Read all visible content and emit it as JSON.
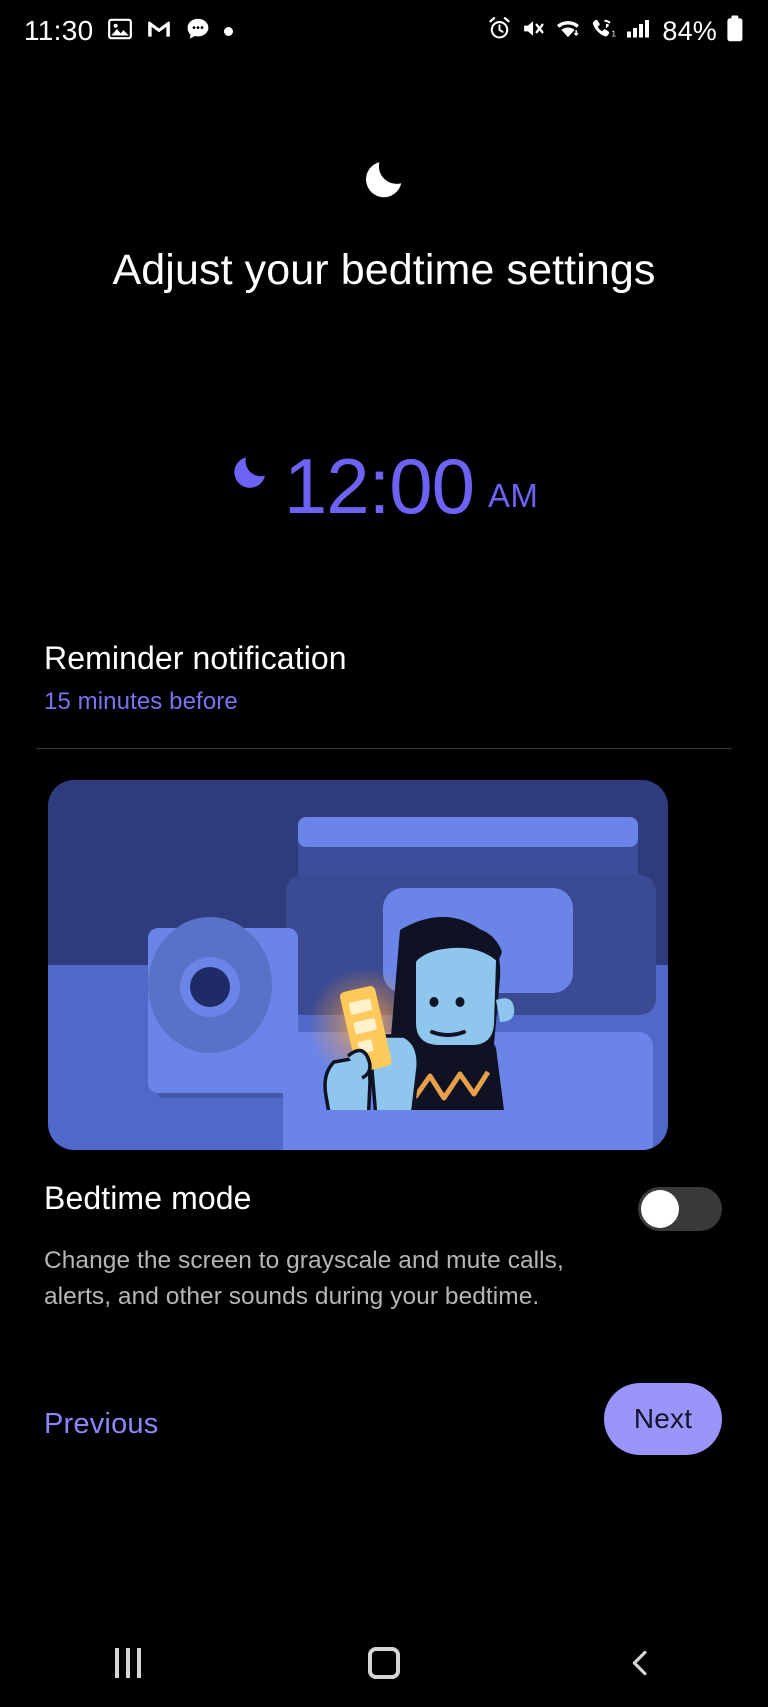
{
  "statusbar": {
    "time": "11:30",
    "battery": "84%",
    "left_icons": [
      "photos-icon",
      "gmail-icon",
      "messages-icon",
      "notification-dot-icon"
    ],
    "right_icons": [
      "alarm-icon",
      "mute-icon",
      "wifi-icon",
      "wifi-calling-icon",
      "signal-bars-icon",
      "battery-icon"
    ]
  },
  "header": {
    "moon_icon": "crescent-moon-icon",
    "title": "Adjust your bedtime settings"
  },
  "bedtime_time": {
    "moon_icon": "crescent-moon-icon",
    "time": "12:00",
    "period": "AM",
    "color": "#6C63F5"
  },
  "reminder": {
    "title": "Reminder notification",
    "value": "15 minutes before",
    "value_color": "#7A73F0"
  },
  "illustration": {
    "name": "person-in-bed-using-phone-illustration",
    "alt": "Person lying in bed at night looking at a glowing phone, lamp beside the bed"
  },
  "bedtime_mode": {
    "title": "Bedtime mode",
    "description": "Change the screen to grayscale and mute calls, alerts, and other sounds during your bedtime.",
    "toggle_state": "off"
  },
  "footer": {
    "previous_label": "Previous",
    "previous_color": "#8B86F8",
    "next_label": "Next",
    "next_bg": "#9B95FB"
  },
  "navbar": {
    "recents": "recents-icon",
    "home": "home-icon",
    "back": "back-icon"
  }
}
